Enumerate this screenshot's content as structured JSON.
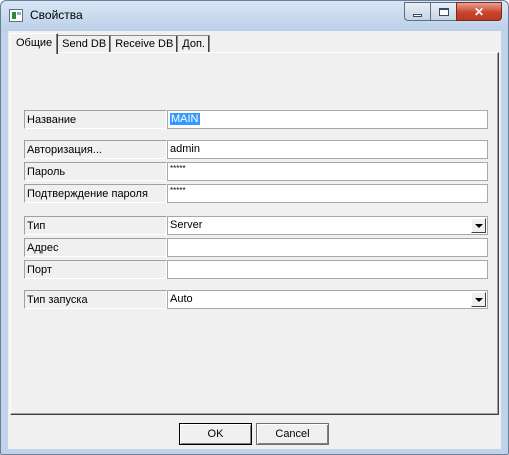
{
  "window": {
    "title": "Свойства",
    "title_icon": "app-properties-icon",
    "controls": {
      "minimize": "minimize-icon",
      "maximize": "maximize-icon",
      "close": "close-icon"
    },
    "close_glyph": "✕"
  },
  "tabs": [
    {
      "label": "Общие",
      "active": true
    },
    {
      "label": "Send DB",
      "active": false
    },
    {
      "label": "Receive DB",
      "active": false
    },
    {
      "label": "Доп.",
      "active": false
    }
  ],
  "form": {
    "name": {
      "label": "Название",
      "value": "MAIN",
      "selected": true
    },
    "auth": {
      "label": "Авторизация...",
      "value": "admin"
    },
    "password": {
      "label": "Пароль",
      "value": "*****"
    },
    "password_confirm": {
      "label": "Подтверждение пароля",
      "value": "*****"
    },
    "type": {
      "label": "Тип",
      "value": "Server"
    },
    "address": {
      "label": "Адрес",
      "value": ""
    },
    "port": {
      "label": "Порт",
      "value": ""
    },
    "launch_type": {
      "label": "Тип запуска",
      "value": "Auto"
    }
  },
  "buttons": {
    "ok": "OK",
    "cancel": "Cancel"
  },
  "colors": {
    "selection": "#3399ff",
    "close_button": "#c9452c",
    "titlebar": "#bcd0e8"
  }
}
